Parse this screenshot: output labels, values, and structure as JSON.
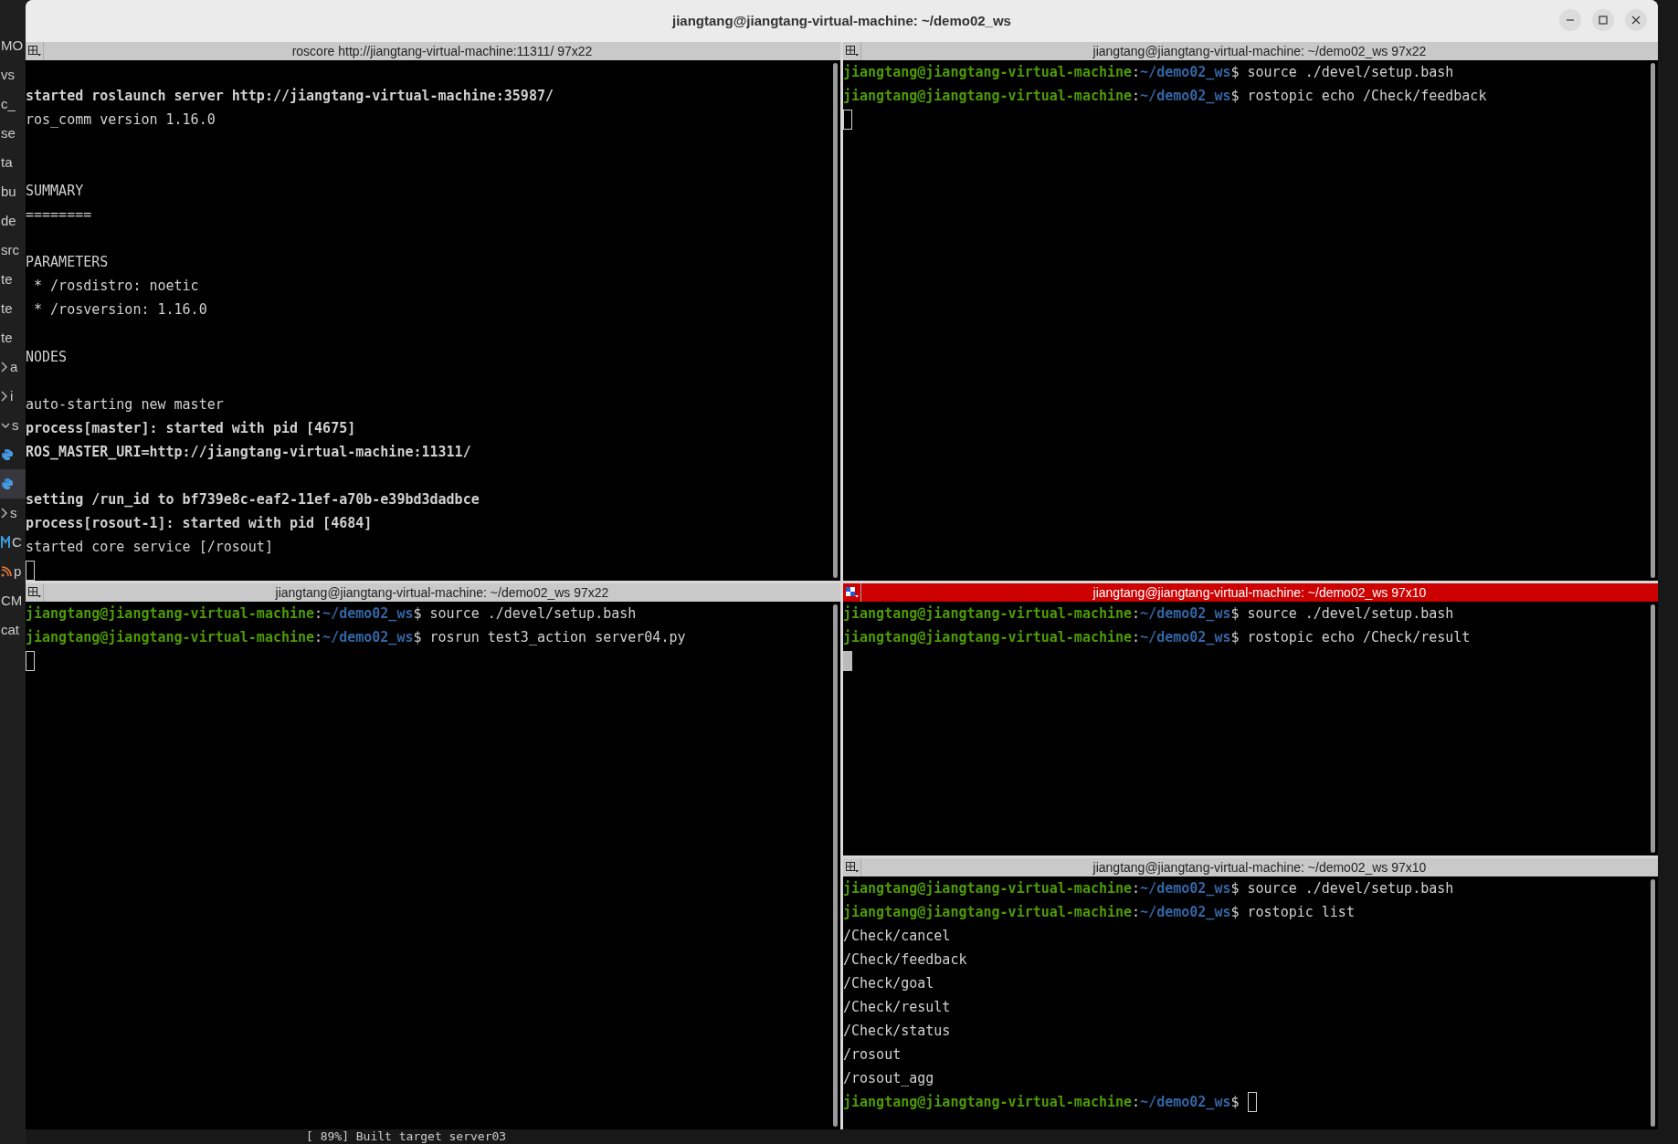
{
  "background": {
    "sidebar": [
      {
        "kind": "text",
        "text": "MO"
      },
      {
        "kind": "text",
        "text": "vs"
      },
      {
        "kind": "text",
        "text": "c_"
      },
      {
        "kind": "text",
        "text": "se"
      },
      {
        "kind": "text",
        "text": "ta"
      },
      {
        "kind": "text",
        "text": "bu"
      },
      {
        "kind": "text",
        "text": "de"
      },
      {
        "kind": "text",
        "text": "src"
      },
      {
        "kind": "text",
        "text": "te"
      },
      {
        "kind": "text",
        "text": "te"
      },
      {
        "kind": "text",
        "text": "te"
      },
      {
        "kind": "folder-closed",
        "text": "a"
      },
      {
        "kind": "folder-closed",
        "text": "i"
      },
      {
        "kind": "folder-open",
        "text": "s"
      },
      {
        "kind": "python-file",
        "selected": false
      },
      {
        "kind": "python-file",
        "selected": true
      },
      {
        "kind": "folder-closed",
        "text": "s"
      },
      {
        "kind": "cmake-file",
        "text": "C"
      },
      {
        "kind": "feed-file",
        "text": "p"
      },
      {
        "kind": "text",
        "text": "CM"
      },
      {
        "kind": "text",
        "text": "cat"
      }
    ],
    "output_line": "[ 89%] Built target server03"
  },
  "window": {
    "title": "jiangtang@jiangtang-virtual-machine: ~/demo02_ws"
  },
  "panes": [
    {
      "title": "roscore http://jiangtang-virtual-machine:11311/ 97x22",
      "active": false,
      "lines": [
        {
          "kind": "blank"
        },
        {
          "kind": "output",
          "text": "started roslaunch server http://jiangtang-virtual-machine:35987/",
          "bold": true
        },
        {
          "kind": "output",
          "text": "ros_comm version 1.16.0",
          "bold": false
        },
        {
          "kind": "blank"
        },
        {
          "kind": "blank"
        },
        {
          "kind": "output",
          "text": "SUMMARY",
          "bold": false
        },
        {
          "kind": "output",
          "text": "========",
          "bold": false
        },
        {
          "kind": "blank"
        },
        {
          "kind": "output",
          "text": "PARAMETERS",
          "bold": false
        },
        {
          "kind": "output",
          "text": " * /rosdistro: noetic",
          "bold": false
        },
        {
          "kind": "output",
          "text": " * /rosversion: 1.16.0",
          "bold": false
        },
        {
          "kind": "blank"
        },
        {
          "kind": "output",
          "text": "NODES",
          "bold": false
        },
        {
          "kind": "blank"
        },
        {
          "kind": "output",
          "text": "auto-starting new master",
          "bold": false
        },
        {
          "kind": "output",
          "text": "process[master]: started with pid [4675]",
          "bold": true
        },
        {
          "kind": "output",
          "text": "ROS_MASTER_URI=http://jiangtang-virtual-machine:11311/",
          "bold": true
        },
        {
          "kind": "blank"
        },
        {
          "kind": "output",
          "text": "setting /run_id to bf739e8c-eaf2-11ef-a70b-e39bd3dadbce",
          "bold": true
        },
        {
          "kind": "output",
          "text": "process[rosout-1]: started with pid [4684]",
          "bold": true
        },
        {
          "kind": "output",
          "text": "started core service [/rosout]",
          "bold": false
        },
        {
          "kind": "cursor"
        }
      ]
    },
    {
      "title": "jiangtang@jiangtang-virtual-machine: ~/demo02_ws 97x22",
      "active": false,
      "lines": [
        {
          "kind": "prompt",
          "user": "jiangtang@jiangtang-virtual-machine",
          "sep": ":",
          "path": "~/demo02_ws",
          "command": "$ source ./devel/setup.bash"
        },
        {
          "kind": "prompt",
          "user": "jiangtang@jiangtang-virtual-machine",
          "sep": ":",
          "path": "~/demo02_ws",
          "command": "$ rostopic echo /Check/feedback"
        },
        {
          "kind": "cursor"
        }
      ]
    },
    {
      "title": "jiangtang@jiangtang-virtual-machine: ~/demo02_ws 97x22",
      "active": false,
      "lines": [
        {
          "kind": "prompt",
          "user": "jiangtang@jiangtang-virtual-machine",
          "sep": ":",
          "path": "~/demo02_ws",
          "command": "$ source ./devel/setup.bash"
        },
        {
          "kind": "prompt",
          "user": "jiangtang@jiangtang-virtual-machine",
          "sep": ":",
          "path": "~/demo02_ws",
          "command": "$ rosrun test3_action server04.py"
        },
        {
          "kind": "cursor"
        }
      ]
    },
    {
      "title": "jiangtang@jiangtang-virtual-machine: ~/demo02_ws 97x10",
      "active": true,
      "lines": [
        {
          "kind": "prompt",
          "user": "jiangtang@jiangtang-virtual-machine",
          "sep": ":",
          "path": "~/demo02_ws",
          "command": "$ source ./devel/setup.bash"
        },
        {
          "kind": "prompt",
          "user": "jiangtang@jiangtang-virtual-machine",
          "sep": ":",
          "path": "~/demo02_ws",
          "command": "$ rostopic echo /Check/result"
        },
        {
          "kind": "cursor"
        }
      ]
    },
    {
      "title": "jiangtang@jiangtang-virtual-machine: ~/demo02_ws 97x10",
      "active": false,
      "lines": [
        {
          "kind": "prompt",
          "user": "jiangtang@jiangtang-virtual-machine",
          "sep": ":",
          "path": "~/demo02_ws",
          "command": "$ source ./devel/setup.bash"
        },
        {
          "kind": "prompt",
          "user": "jiangtang@jiangtang-virtual-machine",
          "sep": ":",
          "path": "~/demo02_ws",
          "command": "$ rostopic list"
        },
        {
          "kind": "output",
          "text": "/Check/cancel",
          "bold": false
        },
        {
          "kind": "output",
          "text": "/Check/feedback",
          "bold": false
        },
        {
          "kind": "output",
          "text": "/Check/goal",
          "bold": false
        },
        {
          "kind": "output",
          "text": "/Check/result",
          "bold": false
        },
        {
          "kind": "output",
          "text": "/Check/status",
          "bold": false
        },
        {
          "kind": "output",
          "text": "/rosout",
          "bold": false
        },
        {
          "kind": "output",
          "text": "/rosout_agg",
          "bold": false
        },
        {
          "kind": "prompt",
          "user": "jiangtang@jiangtang-virtual-machine",
          "sep": ":",
          "path": "~/demo02_ws",
          "command": "$ ",
          "cursor": true
        }
      ]
    }
  ]
}
